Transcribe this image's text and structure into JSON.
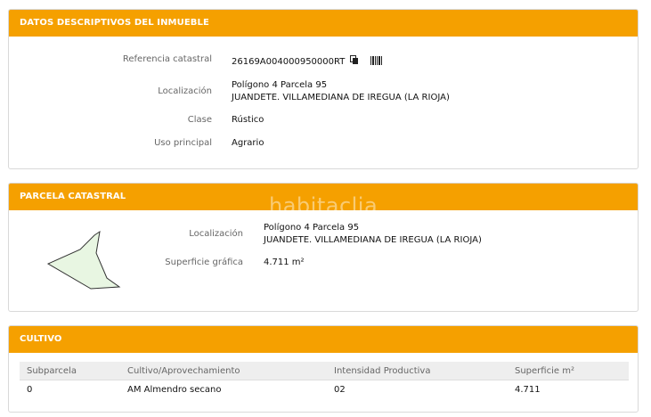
{
  "panels": {
    "datos": {
      "title": "DATOS DESCRIPTIVOS DEL INMUEBLE",
      "ref_label": "Referencia catastral",
      "ref_value": "26169A004000950000RT",
      "loc_label": "Localización",
      "loc_line1": "Polígono 4 Parcela 95",
      "loc_line2": "JUANDETE. VILLAMEDIANA DE IREGUA (LA RIOJA)",
      "clase_label": "Clase",
      "clase_value": "Rústico",
      "uso_label": "Uso principal",
      "uso_value": "Agrario"
    },
    "parcela": {
      "title": "PARCELA CATASTRAL",
      "loc_label": "Localización",
      "loc_line1": "Polígono 4 Parcela 95",
      "loc_line2": "JUANDETE. VILLAMEDIANA DE IREGUA (LA RIOJA)",
      "sup_label": "Superficie gráfica",
      "sup_value": "4.711 m²",
      "watermark": "habitaclia"
    },
    "cultivo": {
      "title": "CULTIVO",
      "columns": [
        "Subparcela",
        "Cultivo/Aprovechamiento",
        "Intensidad Productiva",
        "Superficie m²"
      ],
      "rows": [
        [
          "0",
          "AM Almendro secano",
          "02",
          "4.711"
        ]
      ]
    }
  },
  "colors": {
    "header": "#f5a000",
    "parcel_fill": "#e8f6e2",
    "parcel_stroke": "#333333"
  },
  "icons": [
    "copy-icon",
    "barcode-icon"
  ]
}
